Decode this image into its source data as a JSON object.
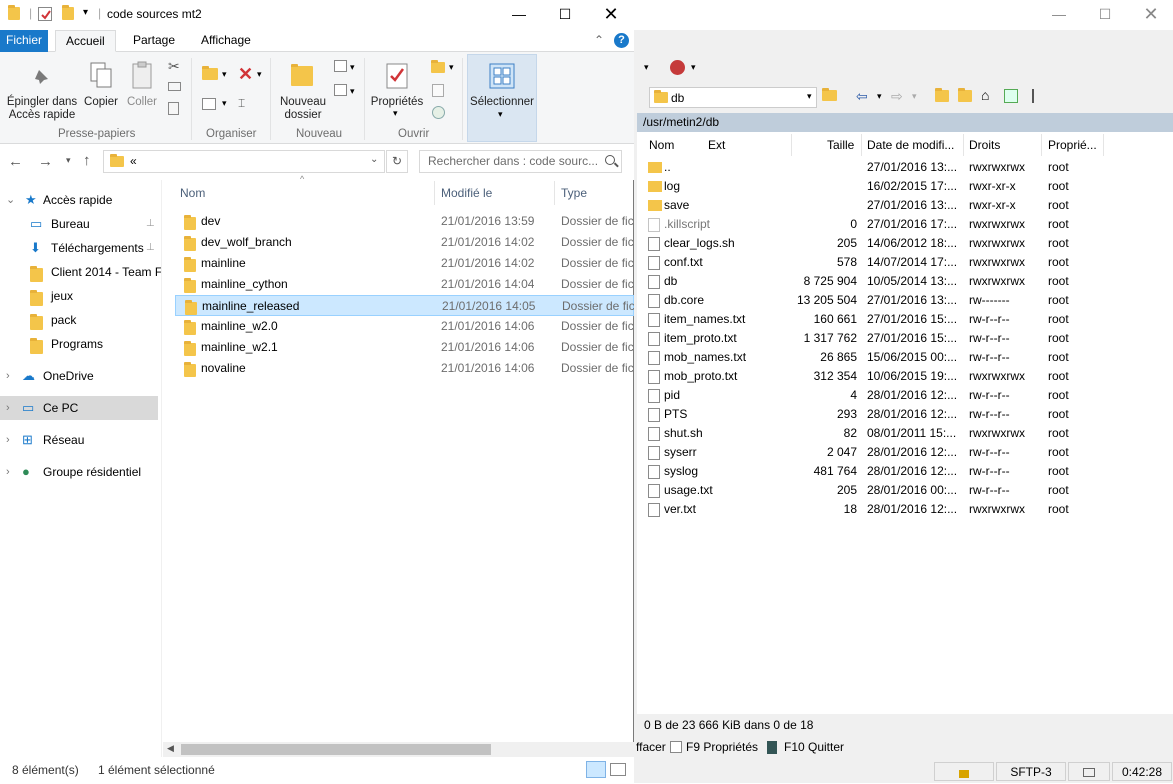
{
  "explorer": {
    "title": "code sources mt2",
    "tabs": {
      "file": "Fichier",
      "home": "Accueil",
      "share": "Partage",
      "view": "Affichage"
    },
    "ribbon": {
      "pin_label": "Épingler dans\nAccès rapide",
      "pin_line1": "Épingler dans",
      "pin_line2": "Accès rapide",
      "copy_label": "Copier",
      "paste_label": "Coller",
      "clipboard_group": "Presse-papiers",
      "organize_group": "Organiser",
      "new_folder_line1": "Nouveau",
      "new_folder_line2": "dossier",
      "new_group": "Nouveau",
      "properties_label": "Propriétés",
      "open_group": "Ouvrir",
      "select_label": "Sélectionner"
    },
    "address": "«",
    "search_placeholder": "Rechercher dans : code sourc...",
    "sidebar": [
      {
        "label": "Accès rapide",
        "icon": "star-icon"
      },
      {
        "label": "Bureau",
        "icon": "desktop-icon"
      },
      {
        "label": "Téléchargements",
        "icon": "download-icon"
      },
      {
        "label": "Client 2014 - Team F",
        "icon": "folder-icon"
      },
      {
        "label": "jeux",
        "icon": "folder-icon"
      },
      {
        "label": "pack",
        "icon": "folder-icon"
      },
      {
        "label": "Programs",
        "icon": "folder-icon"
      },
      {
        "label": "OneDrive",
        "icon": "cloud-icon"
      },
      {
        "label": "Ce PC",
        "icon": "computer-icon"
      },
      {
        "label": "Réseau",
        "icon": "network-icon"
      },
      {
        "label": "Groupe résidentiel",
        "icon": "homegroup-icon"
      }
    ],
    "columns": {
      "name": "Nom",
      "modified": "Modifié le",
      "type": "Type"
    },
    "files": [
      {
        "name": "dev",
        "modified": "21/01/2016 13:59",
        "type": "Dossier de fichiers"
      },
      {
        "name": "dev_wolf_branch",
        "modified": "21/01/2016 14:02",
        "type": "Dossier de fichiers"
      },
      {
        "name": "mainline",
        "modified": "21/01/2016 14:02",
        "type": "Dossier de fichiers"
      },
      {
        "name": "mainline_cython",
        "modified": "21/01/2016 14:04",
        "type": "Dossier de fichiers"
      },
      {
        "name": "mainline_released",
        "modified": "21/01/2016 14:05",
        "type": "Dossier de fichiers"
      },
      {
        "name": "mainline_w2.0",
        "modified": "21/01/2016 14:06",
        "type": "Dossier de fichiers"
      },
      {
        "name": "mainline_w2.1",
        "modified": "21/01/2016 14:06",
        "type": "Dossier de fichiers"
      },
      {
        "name": "novaline",
        "modified": "21/01/2016 14:06",
        "type": "Dossier de fichiers"
      }
    ],
    "status": {
      "count": "8 élément(s)",
      "selected": "1 élément sélectionné"
    }
  },
  "winscp": {
    "path_combo": "db",
    "path": "/usr/metin2/db",
    "columns": {
      "name": "Nom",
      "ext": "Ext",
      "size": "Taille",
      "date": "Date de modifi...",
      "rights": "Droits",
      "owner": "Proprié..."
    },
    "files": [
      {
        "name": "..",
        "size": "",
        "date": "27/01/2016 13:...",
        "rights": "rwxrwxrwx",
        "owner": "root",
        "kind": "up"
      },
      {
        "name": "log",
        "size": "",
        "date": "16/02/2015 17:...",
        "rights": "rwxr-xr-x",
        "owner": "root",
        "kind": "link"
      },
      {
        "name": "save",
        "size": "",
        "date": "27/01/2016 13:...",
        "rights": "rwxr-xr-x",
        "owner": "root",
        "kind": "folder"
      },
      {
        "name": ".killscript",
        "size": "0",
        "date": "27/01/2016 17:...",
        "rights": "rwxrwxrwx",
        "owner": "root",
        "kind": "hidden"
      },
      {
        "name": "clear_logs.sh",
        "size": "205",
        "date": "14/06/2012 18:...",
        "rights": "rwxrwxrwx",
        "owner": "root",
        "kind": "file"
      },
      {
        "name": "conf.txt",
        "size": "578",
        "date": "14/07/2014 17:...",
        "rights": "rwxrwxrwx",
        "owner": "root",
        "kind": "file"
      },
      {
        "name": "db",
        "size": "8 725 904",
        "date": "10/05/2014 13:...",
        "rights": "rwxrwxrwx",
        "owner": "root",
        "kind": "file"
      },
      {
        "name": "db.core",
        "size": "13 205 504",
        "date": "27/01/2016 13:...",
        "rights": "rw-------",
        "owner": "root",
        "kind": "file"
      },
      {
        "name": "item_names.txt",
        "size": "160 661",
        "date": "27/01/2016 15:...",
        "rights": "rw-r--r--",
        "owner": "root",
        "kind": "file"
      },
      {
        "name": "item_proto.txt",
        "size": "1 317 762",
        "date": "27/01/2016 15:...",
        "rights": "rw-r--r--",
        "owner": "root",
        "kind": "file"
      },
      {
        "name": "mob_names.txt",
        "size": "26 865",
        "date": "15/06/2015 00:...",
        "rights": "rw-r--r--",
        "owner": "root",
        "kind": "file"
      },
      {
        "name": "mob_proto.txt",
        "size": "312 354",
        "date": "10/06/2015 19:...",
        "rights": "rwxrwxrwx",
        "owner": "root",
        "kind": "file"
      },
      {
        "name": "pid",
        "size": "4",
        "date": "28/01/2016 12:...",
        "rights": "rw-r--r--",
        "owner": "root",
        "kind": "file"
      },
      {
        "name": "PTS",
        "size": "293",
        "date": "28/01/2016 12:...",
        "rights": "rw-r--r--",
        "owner": "root",
        "kind": "file"
      },
      {
        "name": "shut.sh",
        "size": "82",
        "date": "08/01/2011 15:...",
        "rights": "rwxrwxrwx",
        "owner": "root",
        "kind": "file"
      },
      {
        "name": "syserr",
        "size": "2 047",
        "date": "28/01/2016 12:...",
        "rights": "rw-r--r--",
        "owner": "root",
        "kind": "file"
      },
      {
        "name": "syslog",
        "size": "481 764",
        "date": "28/01/2016 12:...",
        "rights": "rw-r--r--",
        "owner": "root",
        "kind": "file"
      },
      {
        "name": "usage.txt",
        "size": "205",
        "date": "28/01/2016 00:...",
        "rights": "rw-r--r--",
        "owner": "root",
        "kind": "file"
      },
      {
        "name": "ver.txt",
        "size": "18",
        "date": "28/01/2016 12:...",
        "rights": "rwxrwxrwx",
        "owner": "root",
        "kind": "file"
      }
    ],
    "status": "0 B de 23 666 KiB dans 0 de 18",
    "fkeys": {
      "delete": "ffacer",
      "properties": "F9 Propriétés",
      "quit": "F10 Quitter"
    },
    "protocol": "SFTP-3",
    "time": "0:42:28"
  },
  "colors": {
    "accent": "#1979ca",
    "folder": "#f4c54a",
    "selection": "#cce8ff",
    "path_bar": "#bfcddb"
  }
}
